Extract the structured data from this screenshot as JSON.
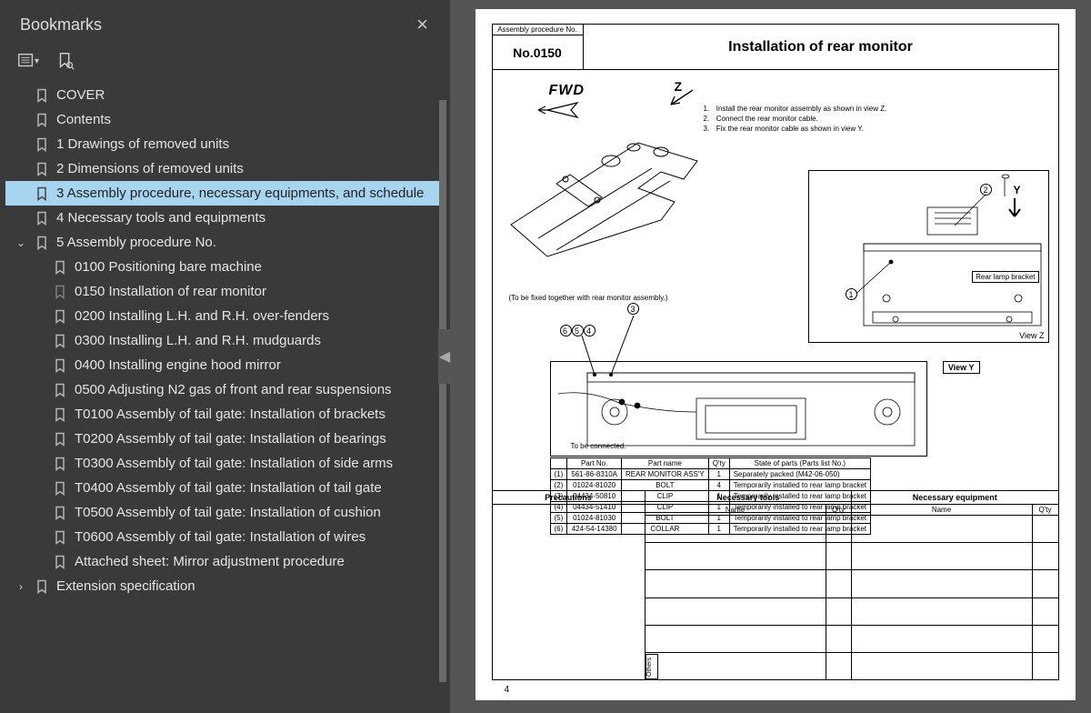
{
  "sidebar": {
    "title": "Bookmarks",
    "items": [
      {
        "label": "COVER",
        "level": 0,
        "light": false
      },
      {
        "label": "Contents",
        "level": 0,
        "light": false
      },
      {
        "label": "1 Drawings of removed units",
        "level": 0,
        "light": false
      },
      {
        "label": "2 Dimensions of removed units",
        "level": 0,
        "light": false
      },
      {
        "label": "3 Assembly procedure, necessary equipments, and schedule",
        "level": 0,
        "selected": true,
        "light": false
      },
      {
        "label": "4 Necessary tools and equipments",
        "level": 0,
        "light": false
      },
      {
        "label": "5 Assembly procedure No.",
        "level": 0,
        "expanded": true,
        "hasChildren": true,
        "light": false
      },
      {
        "label": "0100 Positioning bare machine",
        "level": 1,
        "light": false
      },
      {
        "label": "0150 Installation of rear monitor",
        "level": 1,
        "light": true
      },
      {
        "label": "0200 Installing L.H. and R.H. over-fenders",
        "level": 1,
        "light": false
      },
      {
        "label": "0300 Installing L.H. and R.H. mudguards",
        "level": 1,
        "light": false
      },
      {
        "label": "0400 Installing engine hood mirror",
        "level": 1,
        "light": false
      },
      {
        "label": "0500 Adjusting N2 gas of front and rear suspensions",
        "level": 1,
        "light": false
      },
      {
        "label": "T0100 Assembly of tail gate: Installation of brackets",
        "level": 1,
        "light": false
      },
      {
        "label": "T0200 Assembly of tail gate: Installation of bearings",
        "level": 1,
        "light": false
      },
      {
        "label": "T0300 Assembly of tail gate: Installation of side arms",
        "level": 1,
        "light": false
      },
      {
        "label": "T0400 Assembly of tail gate: Installation of tail gate",
        "level": 1,
        "light": false
      },
      {
        "label": "T0500 Assembly of tail gate: Installation of cushion",
        "level": 1,
        "light": false
      },
      {
        "label": "T0600 Assembly of tail gate: Installation of wires",
        "level": 1,
        "light": false
      },
      {
        "label": "Attached sheet: Mirror adjustment procedure",
        "level": 1,
        "light": false
      },
      {
        "label": "Extension specification",
        "level": 0,
        "collapsed": true,
        "hasChildren": true,
        "light": false
      }
    ]
  },
  "doc": {
    "proc_label": "Assembly procedure No.",
    "proc_no": "No.0150",
    "title": "Installation of rear monitor",
    "fwd": "FWD",
    "z": "Z",
    "instructions": [
      "Install the rear monitor assembly as shown in view Z.",
      "Connect the rear monitor cable.",
      "Fix the rear monitor cable as shown in view Y."
    ],
    "fixed_note": "(To be fixed together with rear monitor assembly.)",
    "viewZ": {
      "label": "View Z",
      "rear_lamp": "Rear lamp bracket",
      "y": "Y"
    },
    "viewY": {
      "label": "View Y",
      "tbc": "To be connected."
    },
    "parts": {
      "headers": [
        "",
        "Part No.",
        "Part name",
        "Q'ty",
        "State of parts (Parts list No.)"
      ],
      "rows": [
        [
          "(1)",
          "561-86-8310A",
          "REAR MONITOR ASS'Y",
          "1",
          "Separately packed (M42-06-050)"
        ],
        [
          "(2)",
          "01024-81020",
          "BOLT",
          "4",
          "Temporarily installed to rear lamp bracket"
        ],
        [
          "(3)",
          "04434-50810",
          "CLIP",
          "1",
          "Temporarily installed to rear lamp bracket"
        ],
        [
          "(4)",
          "04434-51410",
          "CLIP",
          "1",
          "Temporarily installed to rear lamp bracket"
        ],
        [
          "(5)",
          "01024-81030",
          "BOLT",
          "1",
          "Temporarily installed to rear lamp bracket"
        ],
        [
          "(6)",
          "424-54-14380",
          "COLLAR",
          "1",
          "Temporarily installed to rear lamp bracket"
        ]
      ]
    },
    "bottom": {
      "precautions": "Precautions",
      "tools": "Necessary tools",
      "equip": "Necessary equipment",
      "name": "Name",
      "qty": "Q'ty",
      "others": "Others"
    },
    "page_number": "4"
  }
}
